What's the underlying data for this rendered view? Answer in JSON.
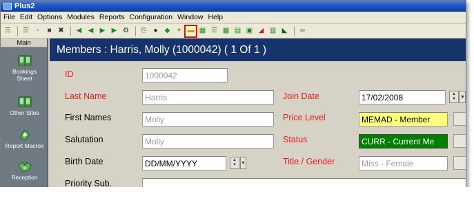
{
  "window": {
    "title": "Plus2"
  },
  "menu": [
    "File",
    "Edit",
    "Options",
    "Modules",
    "Reports",
    "Configuration",
    "Window",
    "Help"
  ],
  "nav": {
    "header": "Main",
    "items": [
      {
        "label": "Bookings Sheet",
        "icon": "book-icon"
      },
      {
        "label": "Other Sites",
        "icon": "book-icon"
      },
      {
        "label": "Report Macros",
        "icon": "macro-icon"
      },
      {
        "label": "Reception",
        "icon": "reception-icon"
      }
    ]
  },
  "record": {
    "header": "Members : Harris, Molly (1000042) ( 1 Of 1 )",
    "labels": {
      "id": "ID",
      "last_name": "Last Name",
      "first_names": "First Names",
      "salutation": "Salutation",
      "birth_date": "Birth Date",
      "priority_sub": "Priority Sub.",
      "join_date": "Join Date",
      "price_level": "Price Level",
      "status": "Status",
      "title_gender": "Title / Gender"
    },
    "values": {
      "id": "1000042",
      "last_name": "Harris",
      "first_names": "Molly",
      "salutation": "Molly",
      "birth_date": "DD/MM/YYYY",
      "priority_sub": "",
      "join_date": "17/02/2008",
      "price_level": "MEMAD - Member",
      "status": "CURR - Current Me",
      "title_gender": "Miss - Female"
    }
  },
  "colors": {
    "required_label": "#e02020",
    "header_bg": "#16336b",
    "price_level_bg": "#ffff80",
    "status_bg": "#008000"
  }
}
